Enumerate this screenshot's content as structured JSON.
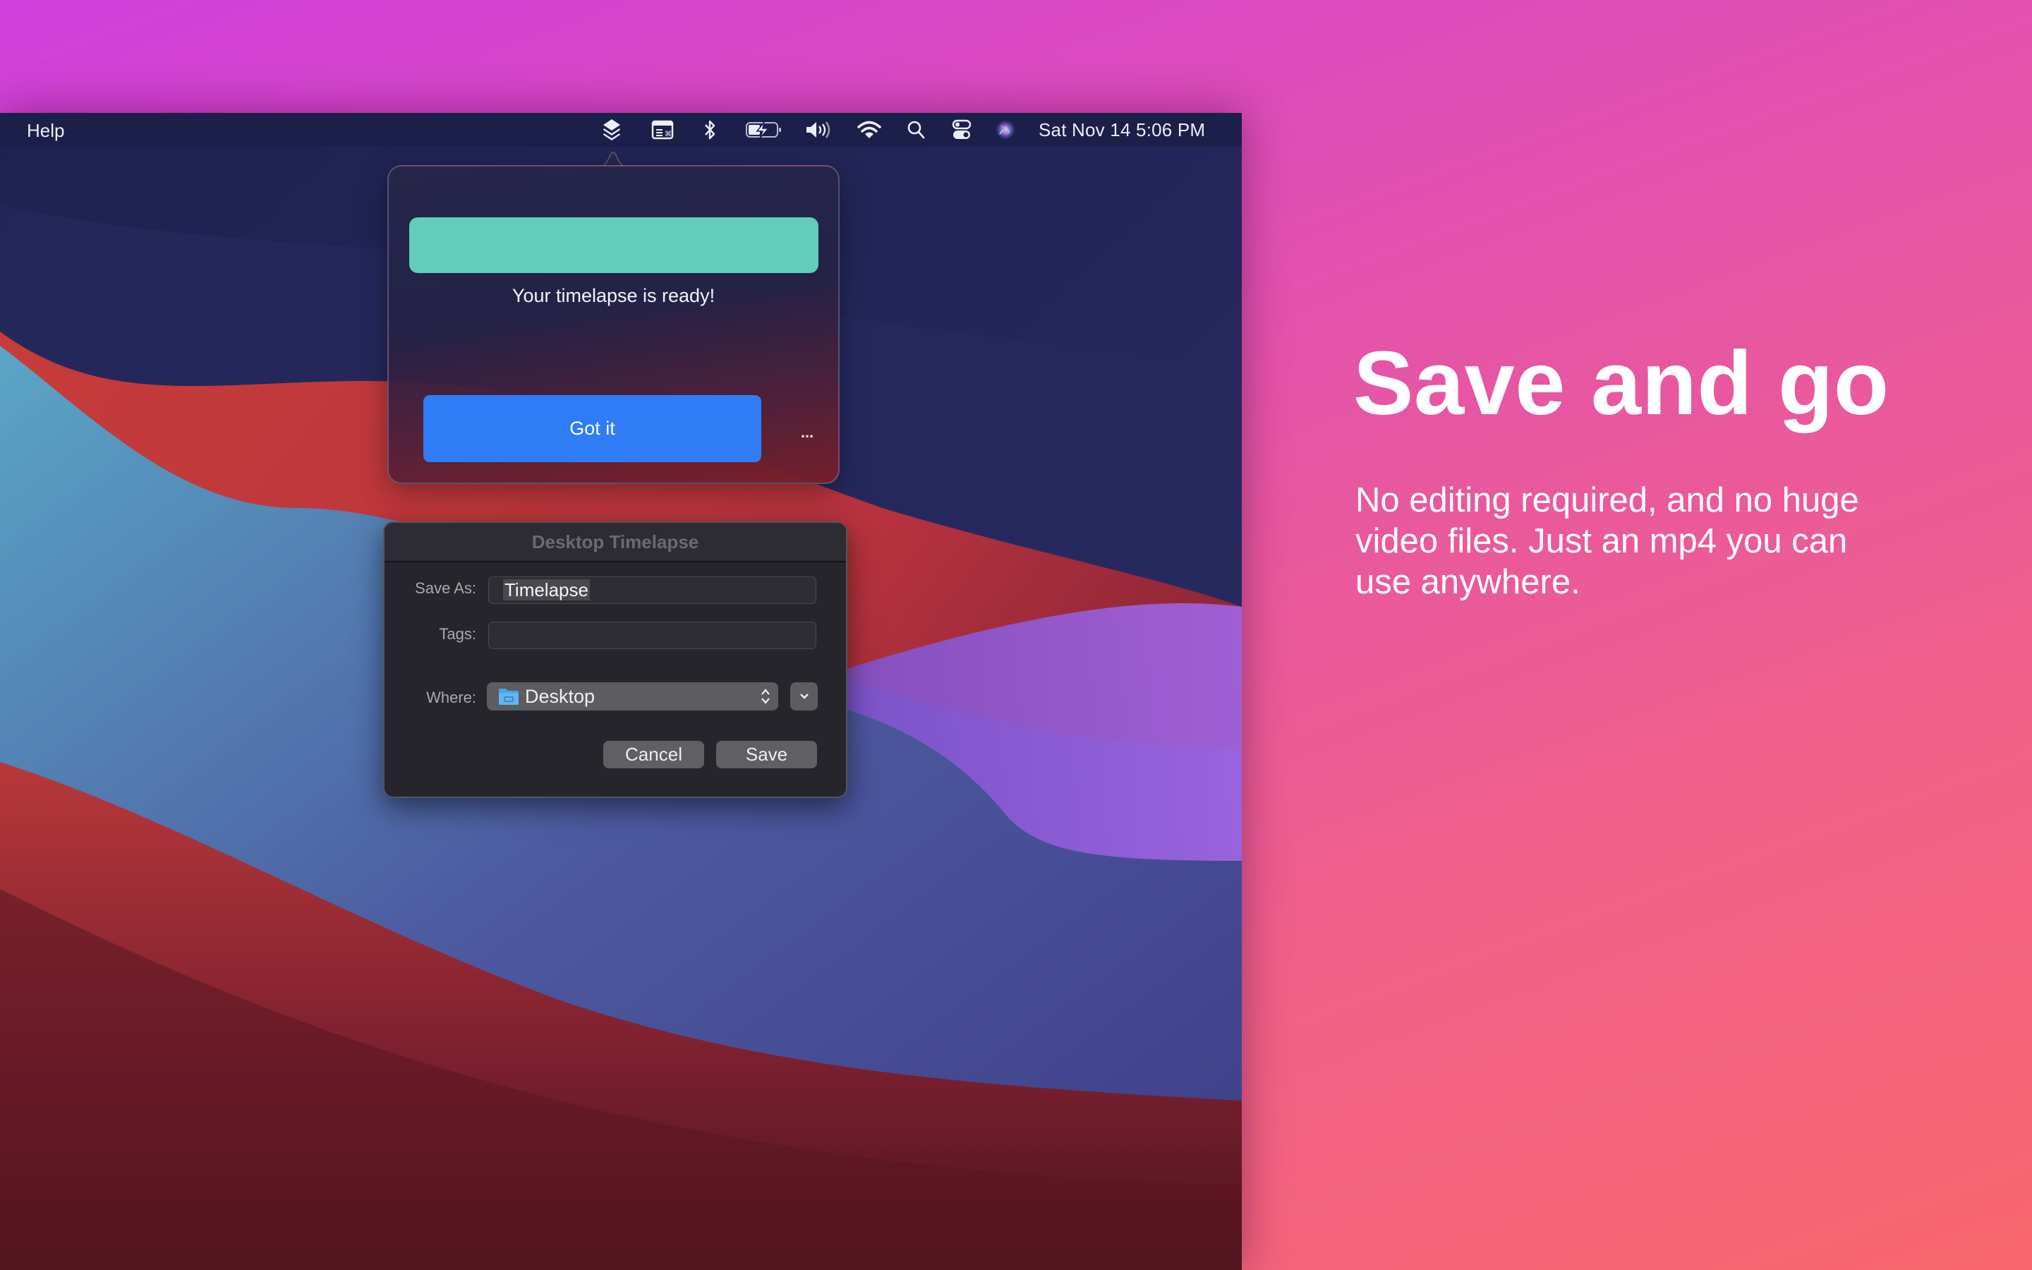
{
  "menubar": {
    "app_menu": "Help",
    "status_icons": [
      "layers-icon",
      "keyboard-viewer-icon",
      "bluetooth-icon",
      "battery-charging-icon",
      "volume-icon",
      "wifi-icon",
      "spotlight-search-icon",
      "control-center-icon",
      "siri-icon"
    ],
    "clock": "Sat Nov 14  5:06 PM"
  },
  "popover": {
    "progress_percent": 100,
    "progress_color": "#62cdbb",
    "message": "Your timelapse is ready!",
    "primary_button": "Got it",
    "primary_color": "#2f7cf6",
    "more_button": "..."
  },
  "save_dialog": {
    "title": "Desktop Timelapse",
    "save_as_label": "Save As:",
    "save_as_value": "Timelapse",
    "tags_label": "Tags:",
    "tags_value": "",
    "where_label": "Where:",
    "where_value": "Desktop",
    "cancel_label": "Cancel",
    "save_label": "Save"
  },
  "marketing": {
    "headline": "Save and go",
    "body": "No editing required, and no huge video files. Just an mp4 you can use anywhere."
  }
}
